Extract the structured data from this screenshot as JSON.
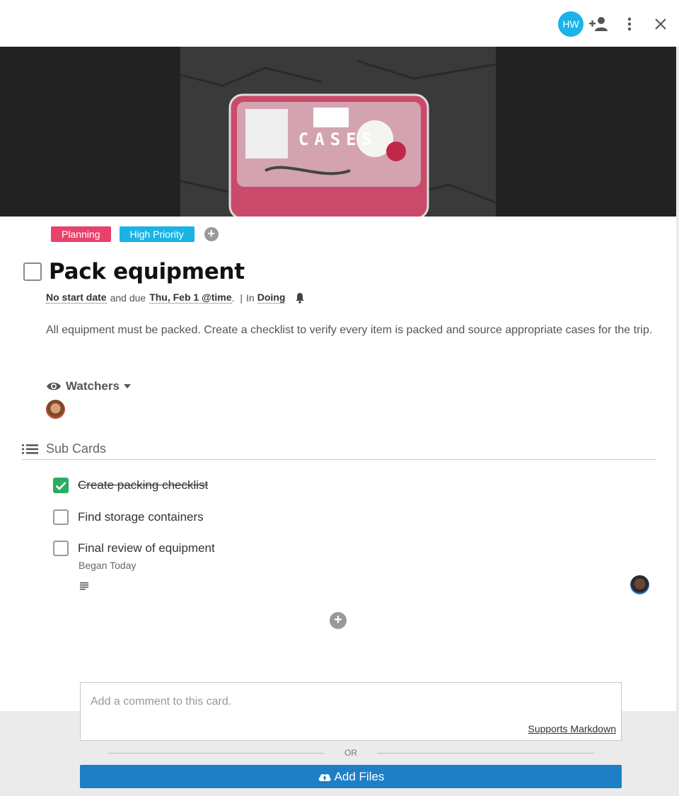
{
  "header": {
    "user_initials": "HW",
    "colors": {
      "avatar": "#1bb3e8"
    },
    "icons": [
      "add-person-icon",
      "more-vertical-icon",
      "close-icon"
    ]
  },
  "cover": {
    "title": "CASES"
  },
  "labels": [
    {
      "text": "Planning",
      "color": "#e8416b"
    },
    {
      "text": "High Priority",
      "color": "#1ab3e6"
    }
  ],
  "card": {
    "title": "Pack equipment",
    "meta": {
      "start": "No start date",
      "and_due": "and due",
      "due": "Thu, Feb 1 @time",
      "period": ".",
      "separator": "|",
      "in": "In",
      "list": "Doing"
    },
    "description": "All equipment must be packed. Create a checklist to verify every item is packed and source appropriate cases for the trip."
  },
  "watchers": {
    "label": "Watchers"
  },
  "sub_cards": {
    "heading": "Sub Cards",
    "items": [
      {
        "text": "Create packing checklist",
        "done": true
      },
      {
        "text": "Find storage containers",
        "done": false
      },
      {
        "text": "Final review of equipment",
        "done": false,
        "note": "Began Today"
      }
    ]
  },
  "comment": {
    "placeholder": "Add a comment to this card.",
    "markdown_link": "Supports Markdown",
    "or": "OR",
    "add_files": "Add Files"
  },
  "colors": {
    "checked": "#27ae60",
    "primary": "#1f7fc6"
  }
}
